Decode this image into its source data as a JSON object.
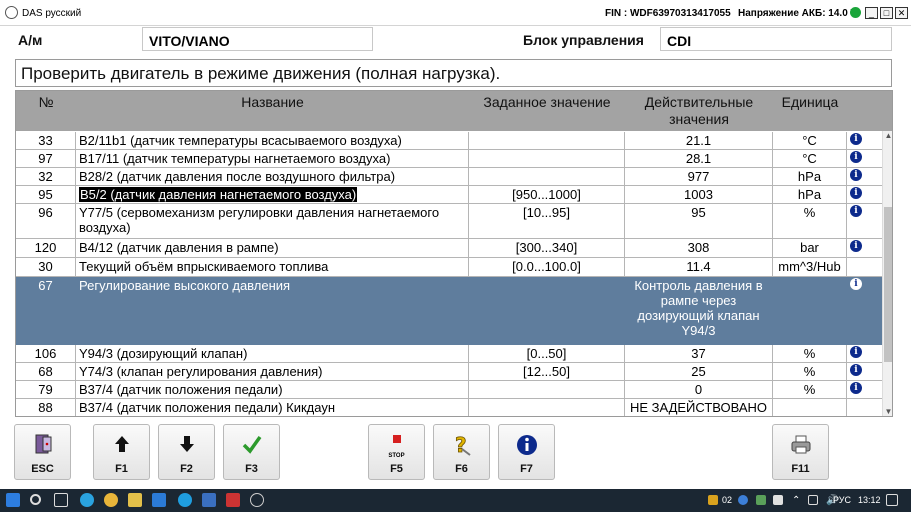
{
  "window": {
    "app_title": "DAS русский",
    "fin": "FIN : WDF63970313417055",
    "battery": "Напряжение АКБ: 14.0 V",
    "btn_min": "_",
    "btn_max": "□",
    "btn_close": "✕"
  },
  "vehicle": {
    "label": "А/м",
    "value": "VITO/VIANO",
    "ecu_label": "Блок управления",
    "ecu_value": "CDI"
  },
  "message": "Проверить двигатель в режиме движения (полная нагрузка).",
  "table": {
    "headers": {
      "num": "№",
      "name": "Название",
      "set": "Заданное значение",
      "actual": "Действительные значения",
      "unit": "Единица"
    },
    "rows": [
      {
        "num": "33",
        "name": "B2/11b1 (датчик температуры всасываемого воздуха)",
        "set": "",
        "actual": "21.1",
        "unit": "°C"
      },
      {
        "num": "97",
        "name": "B17/11 (датчик температуры нагнетаемого воздуха)",
        "set": "",
        "actual": "28.1",
        "unit": "°C"
      },
      {
        "num": "32",
        "name": "B28/2 (датчик давления после воздушного фильтра)",
        "set": "",
        "actual": "977",
        "unit": "hPa"
      },
      {
        "num": "95",
        "name": "B5/2 (датчик давления нагнетаемого воздуха)",
        "set": "[950...1000]",
        "actual": "1003",
        "unit": "hPa"
      },
      {
        "num": "96",
        "name": "Y77/5 (сервомеханизм регулировки давления нагнетаемого воздуха)",
        "set": "[10...95]",
        "actual": "95",
        "unit": "%"
      },
      {
        "num": "120",
        "name": "B4/12 (датчик давления в рампе)",
        "set": "[300...340]",
        "actual": "308",
        "unit": "bar"
      },
      {
        "num": "30",
        "name": "Текущий объём впрыскиваемого топлива",
        "set": "[0.0...100.0]",
        "actual": "11.4",
        "unit": "mm^3/Hub"
      },
      {
        "num": "67",
        "name": "Регулирование высокого давления",
        "set": "",
        "actual": "Контроль давления в рампе через дозирующий клапан Y94/3",
        "unit": ""
      },
      {
        "num": "106",
        "name": "Y94/3 (дозирующий клапан)",
        "set": "[0...50]",
        "actual": "37",
        "unit": "%"
      },
      {
        "num": "68",
        "name": "Y74/3 (клапан регулирования давления)",
        "set": "[12...50]",
        "actual": "25",
        "unit": "%"
      },
      {
        "num": "79",
        "name": "B37/4 (датчик положения педали)",
        "set": "",
        "actual": "0",
        "unit": "%"
      },
      {
        "num": "88",
        "name": "B37/4 (датчик положения педали) Кикдаун",
        "set": "",
        "actual": "НЕ ЗАДЕЙСТВОВАНО",
        "unit": ""
      }
    ]
  },
  "fkeys": {
    "esc": "ESC",
    "f1": "F1",
    "f2": "F2",
    "f3": "F3",
    "stop": "STOP",
    "f5": "F5",
    "f6": "F6",
    "f7": "F7",
    "f11": "F11"
  },
  "taskbar": {
    "lang": "РУС",
    "time": "13:12",
    "badge": "02"
  },
  "colors": {
    "header_gray": "#a3a3a3",
    "group_row": "#5f7d9d",
    "info_blue": "#0d2a8c",
    "ok_green": "#1aa53a"
  }
}
